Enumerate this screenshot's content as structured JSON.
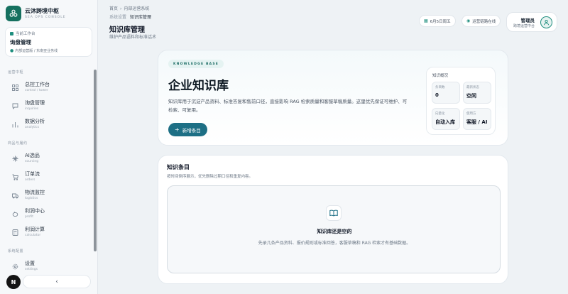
{
  "brand": {
    "name": "云沐跨境中枢",
    "subtitle": "SEA OPS CONSOLE"
  },
  "workspace": {
    "label": "当前工作台",
    "title": "询盘管理",
    "desc": "内部运营版 / 东南亚业务线"
  },
  "sidebar": {
    "groups": [
      {
        "title": "运营中枢",
        "items": [
          {
            "label": "总控工作台",
            "sub": "control / tower",
            "icon": "grid-icon"
          },
          {
            "label": "询盘管理",
            "sub": "inquiries",
            "icon": "chat-icon"
          },
          {
            "label": "数据分析",
            "sub": "analytics",
            "icon": "bar-chart-icon"
          }
        ]
      },
      {
        "title": "商品与履约",
        "items": [
          {
            "label": "AI选品",
            "sub": "sourcing",
            "icon": "sparkle-icon"
          },
          {
            "label": "订单流",
            "sub": "orders",
            "icon": "cart-icon"
          },
          {
            "label": "物流监控",
            "sub": "logistics",
            "icon": "truck-icon"
          },
          {
            "label": "利润中心",
            "sub": "profit",
            "icon": "piggy-bank-icon"
          },
          {
            "label": "利润计算",
            "sub": "calculator",
            "icon": "calculator-icon"
          }
        ]
      },
      {
        "title": "系统配置",
        "items": [
          {
            "label": "设置",
            "sub": "settings",
            "icon": "gear-icon"
          }
        ]
      }
    ],
    "avatar_letter": "N",
    "collapse_icon": "chevron-left-icon"
  },
  "header": {
    "breadcrumb": [
      "首页",
      "内部运营系统"
    ],
    "subcrumb": [
      "系统设置",
      "知识库管理"
    ],
    "title": "知识库管理",
    "subtitle": "维护产品语料和标准话术",
    "date_pill": "6月5日周五",
    "status_pill": "运营链路在线",
    "user_name": "管理员",
    "user_role": "跨境运营中台"
  },
  "hero": {
    "tag": "KNOWLEDGE BASE",
    "title": "企业知识库",
    "desc": "知识库用于沉淀产品资料、标准答复和售前口径，直接影响 RAG 检索质量和客服草稿质量。这里优先保证可维护、可检索、可复用。",
    "new_button": "新增条目"
  },
  "overview": {
    "title": "知识概况",
    "cells": [
      {
        "label": "条目数",
        "value": "0"
      },
      {
        "label": "最新状态",
        "value": "空闲"
      },
      {
        "label": "向量化",
        "value": "自动入库"
      },
      {
        "label": "使用方",
        "value": "客服 / AI"
      }
    ]
  },
  "list": {
    "title": "知识条目",
    "subtitle": "按时间倒序展示，优先删除过期口径和重复内容。",
    "empty_title": "知识库还是空的",
    "empty_desc": "先录几条产品资料、报价规则或标准回答，客服草稿和 RAG 检索才有基础数据。"
  },
  "colors": {
    "accent": "#1e8e7e",
    "primary_button": "#1d6f85"
  }
}
